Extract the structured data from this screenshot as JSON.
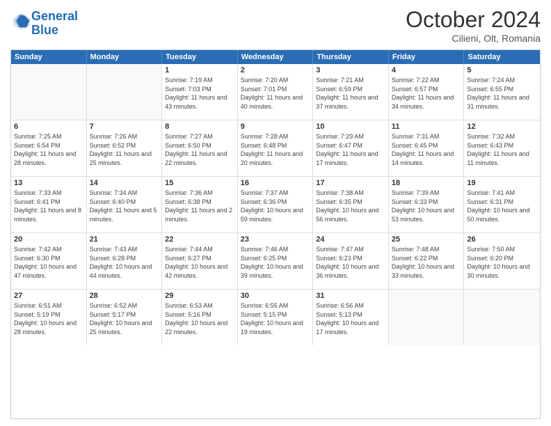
{
  "header": {
    "logo_general": "General",
    "logo_blue": "Blue",
    "month": "October 2024",
    "location": "Cilieni, Olt, Romania"
  },
  "days_of_week": [
    "Sunday",
    "Monday",
    "Tuesday",
    "Wednesday",
    "Thursday",
    "Friday",
    "Saturday"
  ],
  "weeks": [
    [
      {
        "day": "",
        "empty": true
      },
      {
        "day": "",
        "empty": true
      },
      {
        "day": "1",
        "sunrise": "Sunrise: 7:19 AM",
        "sunset": "Sunset: 7:03 PM",
        "daylight": "Daylight: 11 hours and 43 minutes."
      },
      {
        "day": "2",
        "sunrise": "Sunrise: 7:20 AM",
        "sunset": "Sunset: 7:01 PM",
        "daylight": "Daylight: 11 hours and 40 minutes."
      },
      {
        "day": "3",
        "sunrise": "Sunrise: 7:21 AM",
        "sunset": "Sunset: 6:59 PM",
        "daylight": "Daylight: 11 hours and 37 minutes."
      },
      {
        "day": "4",
        "sunrise": "Sunrise: 7:22 AM",
        "sunset": "Sunset: 6:57 PM",
        "daylight": "Daylight: 11 hours and 34 minutes."
      },
      {
        "day": "5",
        "sunrise": "Sunrise: 7:24 AM",
        "sunset": "Sunset: 6:55 PM",
        "daylight": "Daylight: 11 hours and 31 minutes."
      }
    ],
    [
      {
        "day": "6",
        "sunrise": "Sunrise: 7:25 AM",
        "sunset": "Sunset: 6:54 PM",
        "daylight": "Daylight: 11 hours and 28 minutes."
      },
      {
        "day": "7",
        "sunrise": "Sunrise: 7:26 AM",
        "sunset": "Sunset: 6:52 PM",
        "daylight": "Daylight: 11 hours and 25 minutes."
      },
      {
        "day": "8",
        "sunrise": "Sunrise: 7:27 AM",
        "sunset": "Sunset: 6:50 PM",
        "daylight": "Daylight: 11 hours and 22 minutes."
      },
      {
        "day": "9",
        "sunrise": "Sunrise: 7:28 AM",
        "sunset": "Sunset: 6:48 PM",
        "daylight": "Daylight: 11 hours and 20 minutes."
      },
      {
        "day": "10",
        "sunrise": "Sunrise: 7:29 AM",
        "sunset": "Sunset: 6:47 PM",
        "daylight": "Daylight: 11 hours and 17 minutes."
      },
      {
        "day": "11",
        "sunrise": "Sunrise: 7:31 AM",
        "sunset": "Sunset: 6:45 PM",
        "daylight": "Daylight: 11 hours and 14 minutes."
      },
      {
        "day": "12",
        "sunrise": "Sunrise: 7:32 AM",
        "sunset": "Sunset: 6:43 PM",
        "daylight": "Daylight: 11 hours and 11 minutes."
      }
    ],
    [
      {
        "day": "13",
        "sunrise": "Sunrise: 7:33 AM",
        "sunset": "Sunset: 6:41 PM",
        "daylight": "Daylight: 11 hours and 8 minutes."
      },
      {
        "day": "14",
        "sunrise": "Sunrise: 7:34 AM",
        "sunset": "Sunset: 6:40 PM",
        "daylight": "Daylight: 11 hours and 5 minutes."
      },
      {
        "day": "15",
        "sunrise": "Sunrise: 7:36 AM",
        "sunset": "Sunset: 6:38 PM",
        "daylight": "Daylight: 11 hours and 2 minutes."
      },
      {
        "day": "16",
        "sunrise": "Sunrise: 7:37 AM",
        "sunset": "Sunset: 6:36 PM",
        "daylight": "Daylight: 10 hours and 59 minutes."
      },
      {
        "day": "17",
        "sunrise": "Sunrise: 7:38 AM",
        "sunset": "Sunset: 6:35 PM",
        "daylight": "Daylight: 10 hours and 56 minutes."
      },
      {
        "day": "18",
        "sunrise": "Sunrise: 7:39 AM",
        "sunset": "Sunset: 6:33 PM",
        "daylight": "Daylight: 10 hours and 53 minutes."
      },
      {
        "day": "19",
        "sunrise": "Sunrise: 7:41 AM",
        "sunset": "Sunset: 6:31 PM",
        "daylight": "Daylight: 10 hours and 50 minutes."
      }
    ],
    [
      {
        "day": "20",
        "sunrise": "Sunrise: 7:42 AM",
        "sunset": "Sunset: 6:30 PM",
        "daylight": "Daylight: 10 hours and 47 minutes."
      },
      {
        "day": "21",
        "sunrise": "Sunrise: 7:43 AM",
        "sunset": "Sunset: 6:28 PM",
        "daylight": "Daylight: 10 hours and 44 minutes."
      },
      {
        "day": "22",
        "sunrise": "Sunrise: 7:44 AM",
        "sunset": "Sunset: 6:27 PM",
        "daylight": "Daylight: 10 hours and 42 minutes."
      },
      {
        "day": "23",
        "sunrise": "Sunrise: 7:46 AM",
        "sunset": "Sunset: 6:25 PM",
        "daylight": "Daylight: 10 hours and 39 minutes."
      },
      {
        "day": "24",
        "sunrise": "Sunrise: 7:47 AM",
        "sunset": "Sunset: 6:23 PM",
        "daylight": "Daylight: 10 hours and 36 minutes."
      },
      {
        "day": "25",
        "sunrise": "Sunrise: 7:48 AM",
        "sunset": "Sunset: 6:22 PM",
        "daylight": "Daylight: 10 hours and 33 minutes."
      },
      {
        "day": "26",
        "sunrise": "Sunrise: 7:50 AM",
        "sunset": "Sunset: 6:20 PM",
        "daylight": "Daylight: 10 hours and 30 minutes."
      }
    ],
    [
      {
        "day": "27",
        "sunrise": "Sunrise: 6:51 AM",
        "sunset": "Sunset: 5:19 PM",
        "daylight": "Daylight: 10 hours and 28 minutes."
      },
      {
        "day": "28",
        "sunrise": "Sunrise: 6:52 AM",
        "sunset": "Sunset: 5:17 PM",
        "daylight": "Daylight: 10 hours and 25 minutes."
      },
      {
        "day": "29",
        "sunrise": "Sunrise: 6:53 AM",
        "sunset": "Sunset: 5:16 PM",
        "daylight": "Daylight: 10 hours and 22 minutes."
      },
      {
        "day": "30",
        "sunrise": "Sunrise: 6:55 AM",
        "sunset": "Sunset: 5:15 PM",
        "daylight": "Daylight: 10 hours and 19 minutes."
      },
      {
        "day": "31",
        "sunrise": "Sunrise: 6:56 AM",
        "sunset": "Sunset: 5:13 PM",
        "daylight": "Daylight: 10 hours and 17 minutes."
      },
      {
        "day": "",
        "empty": true
      },
      {
        "day": "",
        "empty": true
      }
    ]
  ]
}
